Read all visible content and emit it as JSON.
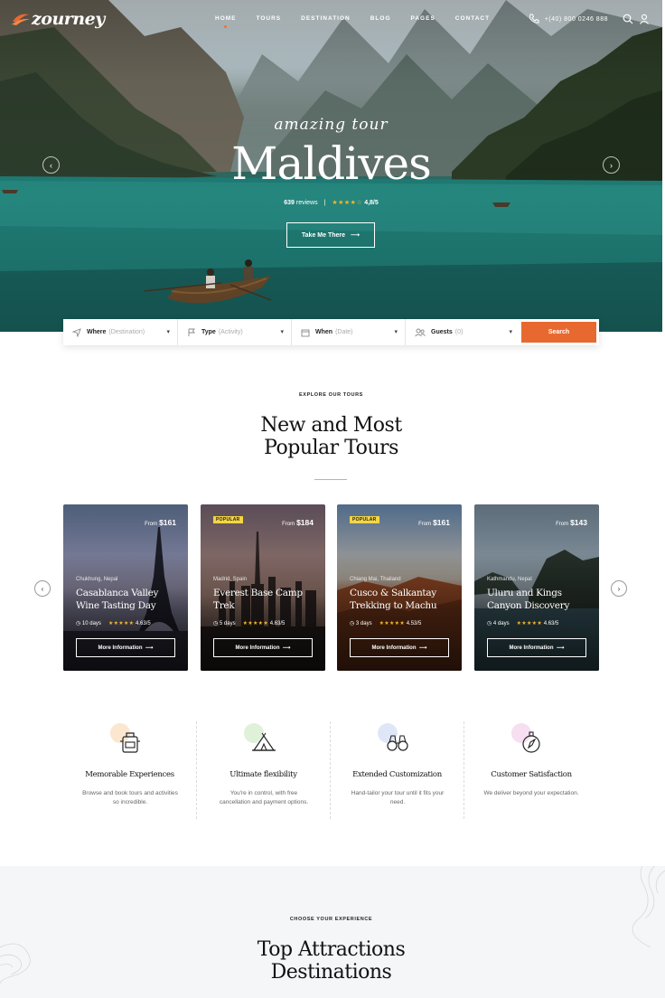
{
  "brand": {
    "name": "zourney",
    "accent": "#e8692f"
  },
  "nav": {
    "items": [
      {
        "label": "HOME",
        "active": true
      },
      {
        "label": "TOURS"
      },
      {
        "label": "DESTINATION"
      },
      {
        "label": "BLOG"
      },
      {
        "label": "PAGES"
      },
      {
        "label": "CONTACT"
      }
    ],
    "phone": "+(40) 800 0246 888",
    "icons": [
      "phone-icon",
      "search-icon",
      "user-icon"
    ]
  },
  "hero": {
    "script": "amazing tour",
    "title": "Maldives",
    "reviews": "639",
    "reviews_label": "reviews",
    "rating": "4,8/5",
    "cta": "Take Me There",
    "rating_value": 4.8
  },
  "search": {
    "fields": [
      {
        "label": "Where",
        "placeholder": "(Destination)",
        "icon": "location-icon"
      },
      {
        "label": "Type",
        "placeholder": "(Activity)",
        "icon": "flag-icon"
      },
      {
        "label": "When",
        "placeholder": "(Date)",
        "icon": "calendar-icon"
      },
      {
        "label": "Guests",
        "placeholder": "(0)",
        "icon": "guests-icon"
      }
    ],
    "button": "Search"
  },
  "tours": {
    "eyebrow": "EXPLORE OUR TOURS",
    "title_line1": "New and Most",
    "title_line2": "Popular Tours",
    "cards": [
      {
        "badge": "",
        "price_from": "From",
        "price": "$161",
        "location": "Chukhung, Nepal",
        "title": "Casablanca Valley Wine Tasting Day",
        "duration": "10 days",
        "rating": "4.63/5",
        "button": "More Information"
      },
      {
        "badge": "POPULAR",
        "price_from": "From",
        "price": "$184",
        "location": "Madrid, Spain",
        "title": "Everest Base Camp Trek",
        "duration": "5 days",
        "rating": "4.63/5",
        "button": "More Information"
      },
      {
        "badge": "POPULAR",
        "price_from": "From",
        "price": "$161",
        "location": "Chiang Mai, Thailand",
        "title": "Cusco & Salkantay Trekking to Machu",
        "duration": "3 days",
        "rating": "4.53/5",
        "button": "More Information"
      },
      {
        "badge": "",
        "price_from": "From",
        "price": "$143",
        "location": "Kathmandu, Nepal",
        "title": "Uluru and Kings Canyon Discovery",
        "duration": "4 days",
        "rating": "4.63/5",
        "button": "More Information"
      }
    ]
  },
  "features": [
    {
      "title": "Memorable Experiences",
      "desc": "Browse and book tours and activities so incredible.",
      "icon": "backpack-icon",
      "blob": "#fbe6cf"
    },
    {
      "title": "Ultimate flexibility",
      "desc": "You're in control, with free cancellation and payment options.",
      "icon": "tent-icon",
      "blob": "#dff1d8"
    },
    {
      "title": "Extended Customization",
      "desc": "Hand-tailor your tour until it fits your need.",
      "icon": "binoculars-icon",
      "blob": "#dfe6f7"
    },
    {
      "title": "Customer Satisfaction",
      "desc": "We deliver beyond your expectation.",
      "icon": "compass-icon",
      "blob": "#f6dff0"
    }
  ],
  "attractions": {
    "eyebrow": "CHOOSE YOUR EXPERIENCE",
    "title_line1": "Top Attractions",
    "title_line2": "Destinations"
  }
}
